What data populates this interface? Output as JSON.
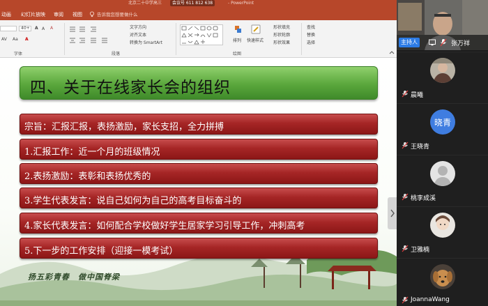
{
  "ppt": {
    "title_text": "北京二十中学高三",
    "title_suffix": "- PowerPoint",
    "meeting_id": "会议号 611 812 638",
    "menu": [
      "动画",
      "幻灯片放映",
      "审阅",
      "视图"
    ],
    "tell_me_placeholder": "告诉我您想要做什么",
    "ribbon": {
      "font_size_value": "40+",
      "group_font_label": "字体",
      "group_paragraph_label": "段落",
      "group_drawing_label": "绘图",
      "text_direction": "文字方向",
      "align_text": "对齐文本",
      "convert_smartart": "转换为 SmartArt",
      "arrange": "排列",
      "quick_styles": "快速样式",
      "shape_fill": "形状填充",
      "shape_outline": "形状轮廓",
      "shape_effects": "形状效果",
      "find": "查找",
      "replace": "替换",
      "select": "选择"
    },
    "slide": {
      "title": "四、关于在线家长会的组织",
      "items": [
        "宗旨：汇报汇报，表扬激励，家长支招，全力拼搏",
        "1.汇报工作：近一个月的班级情况",
        "2.表扬激励：表彰和表扬优秀的",
        "3.学生代表发言：说自己如何为自己的高考目标奋斗的",
        "4.家长代表发言：如何配合学校做好学生居家学习引导工作，冲刺高考",
        "5.下一步的工作安排（迎接一模考试）"
      ],
      "motto": "扬五彩青春　做中国脊梁"
    }
  },
  "meeting": {
    "host_label": "主持人",
    "host_name": "张万祥",
    "participants": [
      {
        "name": "晨曦",
        "avatar": "photo-avatar"
      },
      {
        "name": "王晓青",
        "avatar": "text-avatar",
        "avatar_text": "晓青",
        "avatar_color": "#3f7de0"
      },
      {
        "name": "桃李成溪",
        "avatar": "default-person-avatar"
      },
      {
        "name": "卫雅楠",
        "avatar": "photo-avatar"
      },
      {
        "name": "JoannaWang",
        "avatar": "dog-photo-avatar"
      }
    ]
  },
  "colors": {
    "ppt_brand": "#b7472a",
    "title_green": "#5aa73c",
    "bar_red": "#a62626",
    "host_badge": "#2c7be5"
  }
}
